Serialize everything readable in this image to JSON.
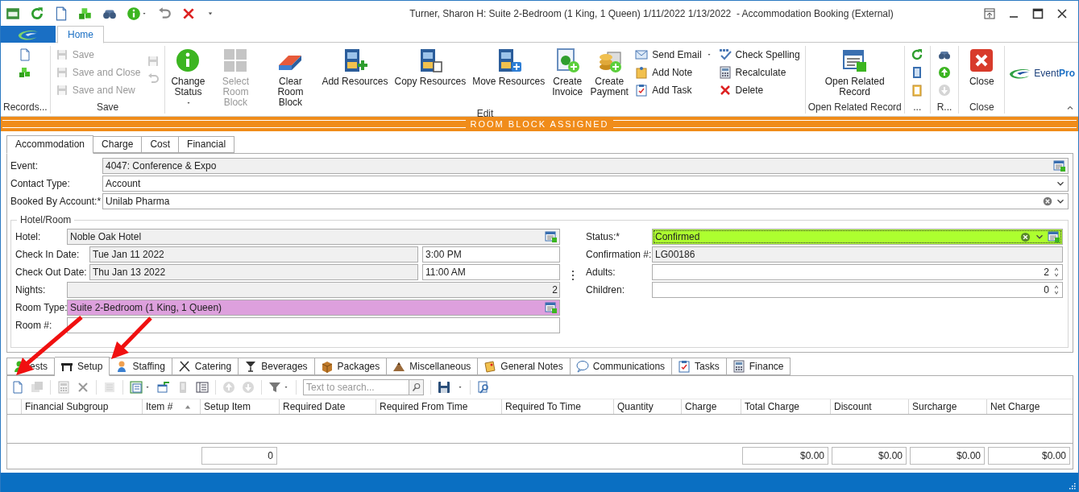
{
  "window": {
    "title": "Turner, Sharon H: Suite 2-Bedroom (1 King, 1 Queen) 1/11/2022 1/13/2022  - Accommodation Booking (External)"
  },
  "ribbon": {
    "tabs": [
      {
        "label": "Home",
        "selected": true
      }
    ],
    "groups": [
      {
        "label": "Records...",
        "items": [
          {
            "kind": "icon",
            "disabled": false
          },
          {
            "kind": "icon",
            "disabled": false
          }
        ]
      },
      {
        "label": "Save",
        "items": [
          {
            "kind": "small",
            "label": "Save",
            "disabled": true
          },
          {
            "kind": "small",
            "label": "Save and Close",
            "disabled": true
          },
          {
            "kind": "small",
            "label": "Save and New",
            "disabled": true
          },
          {
            "kind": "icon",
            "disabled": true
          },
          {
            "kind": "icon",
            "disabled": true
          }
        ]
      },
      {
        "label": "Edit",
        "items": [
          {
            "kind": "large",
            "label": "Change Status",
            "dropdown": true,
            "disabled": false
          },
          {
            "kind": "large",
            "label": "Select Room Block",
            "disabled": true
          },
          {
            "kind": "large",
            "label": "Clear Room Block",
            "disabled": false
          },
          {
            "kind": "large",
            "label": "Add Resources",
            "disabled": false
          },
          {
            "kind": "large",
            "label": "Copy Resources",
            "disabled": false
          },
          {
            "kind": "large",
            "label": "Move Resources",
            "disabled": false
          },
          {
            "kind": "large",
            "label": "Create Invoice",
            "disabled": false
          },
          {
            "kind": "large",
            "label": "Create Payment",
            "disabled": false
          },
          {
            "kind": "small",
            "label": "Send Email",
            "dropdown": true,
            "disabled": false
          },
          {
            "kind": "small",
            "label": "Add Note",
            "disabled": false
          },
          {
            "kind": "small",
            "label": "Add Task",
            "disabled": false
          },
          {
            "kind": "small",
            "label": "Check Spelling",
            "disabled": false
          },
          {
            "kind": "small",
            "label": "Recalculate",
            "disabled": false
          },
          {
            "kind": "small",
            "label": "Delete",
            "disabled": false
          }
        ]
      },
      {
        "label": "Open Related Record",
        "items": [
          {
            "kind": "large",
            "label": "Open Related Record",
            "disabled": false
          }
        ]
      },
      {
        "label": "...",
        "items": [
          {
            "kind": "icon",
            "disabled": false
          },
          {
            "kind": "icon",
            "disabled": false
          },
          {
            "kind": "icon",
            "disabled": false
          }
        ]
      },
      {
        "label": "R...",
        "items": [
          {
            "kind": "icon",
            "disabled": false
          },
          {
            "kind": "icon",
            "disabled": false
          },
          {
            "kind": "icon",
            "disabled": true
          }
        ]
      },
      {
        "label": "Close",
        "items": [
          {
            "kind": "large",
            "label": "Close",
            "disabled": false
          }
        ]
      }
    ],
    "logo": "Event**Pro**"
  },
  "banner": "ROOM BLOCK ASSIGNED",
  "form": {
    "tabs": [
      {
        "label": "Accommodation",
        "selected": true
      },
      {
        "label": "Charge",
        "selected": false
      },
      {
        "label": "Cost",
        "selected": false
      },
      {
        "label": "Financial",
        "selected": false
      }
    ],
    "fields": [
      {
        "label": "Event:",
        "value": "4047: Conference & Expo",
        "kind": "lookup",
        "readonly": true
      },
      {
        "label": "Contact Type:",
        "value": "Account",
        "kind": "dropdown",
        "readonly": false
      },
      {
        "label": "Booked By Account:*",
        "value": "Unilab Pharma",
        "kind": "combo",
        "readonly": false
      }
    ],
    "hotel_room": {
      "title": "Hotel/Room",
      "left": [
        {
          "label": "Hotel:",
          "value": "Noble Oak Hotel",
          "kind": "lookup",
          "readonly": true
        },
        {
          "label": "Check In Date:",
          "value": "Tue Jan 11 2022",
          "time": "3:00 PM",
          "kind": "date_time",
          "readonly": true
        },
        {
          "label": "Check Out Date:",
          "value": "Thu Jan 13 2022",
          "time": "11:00 AM",
          "kind": "date_time",
          "readonly": true
        },
        {
          "label": "Nights:",
          "value": "2",
          "kind": "number",
          "readonly": true
        },
        {
          "label": "Room Type:",
          "value": "Suite 2-Bedroom (1 King, 1 Queen)",
          "kind": "lookup",
          "color": "#dda0dd"
        },
        {
          "label": "Room #:",
          "kind": "text",
          "readonly": false
        }
      ],
      "right": [
        {
          "label": "Status:*",
          "value": "Confirmed",
          "kind": "status",
          "color": "#adff2f"
        },
        {
          "label": "Confirmation #:",
          "value": "LG00186",
          "kind": "text",
          "readonly": true
        },
        {
          "label": "Adults:",
          "value": "2",
          "kind": "spin",
          "readonly": false
        },
        {
          "label": "Children:",
          "value": "0",
          "kind": "spin",
          "readonly": false
        }
      ]
    }
  },
  "detail": {
    "tabs": [
      {
        "label": "ests",
        "selected": false
      },
      {
        "label": "Setup",
        "selected": true
      },
      {
        "label": "Staffing",
        "selected": false
      },
      {
        "label": "Catering",
        "selected": false
      },
      {
        "label": "Beverages",
        "selected": false
      },
      {
        "label": "Packages",
        "selected": false
      },
      {
        "label": "Miscellaneous",
        "selected": false
      },
      {
        "label": "General Notes",
        "selected": false
      },
      {
        "label": "Communications",
        "selected": false
      },
      {
        "label": "Tasks",
        "selected": false
      },
      {
        "label": "Finance",
        "selected": false
      }
    ],
    "search": {
      "placeholder": "Text to search..."
    },
    "table": {
      "columns": [
        {
          "label": "Financial Subgroup",
          "sorted": false
        },
        {
          "label": "Item #",
          "sorted": true
        },
        {
          "label": "Setup Item",
          "sorted": false,
          "total": "0"
        },
        {
          "label": "Required Date",
          "sorted": false
        },
        {
          "label": "Required From Time",
          "sorted": false
        },
        {
          "label": "Required To Time",
          "sorted": false
        },
        {
          "label": "Quantity",
          "sorted": false
        },
        {
          "label": "Charge",
          "sorted": false
        },
        {
          "label": "Total Charge",
          "sorted": false,
          "total": "$0.00"
        },
        {
          "label": "Discount",
          "sorted": false,
          "total": "$0.00"
        },
        {
          "label": "Surcharge",
          "sorted": false,
          "total": "$0.00"
        },
        {
          "label": "Net Charge",
          "sorted": false,
          "total": "$0.00"
        }
      ]
    }
  }
}
